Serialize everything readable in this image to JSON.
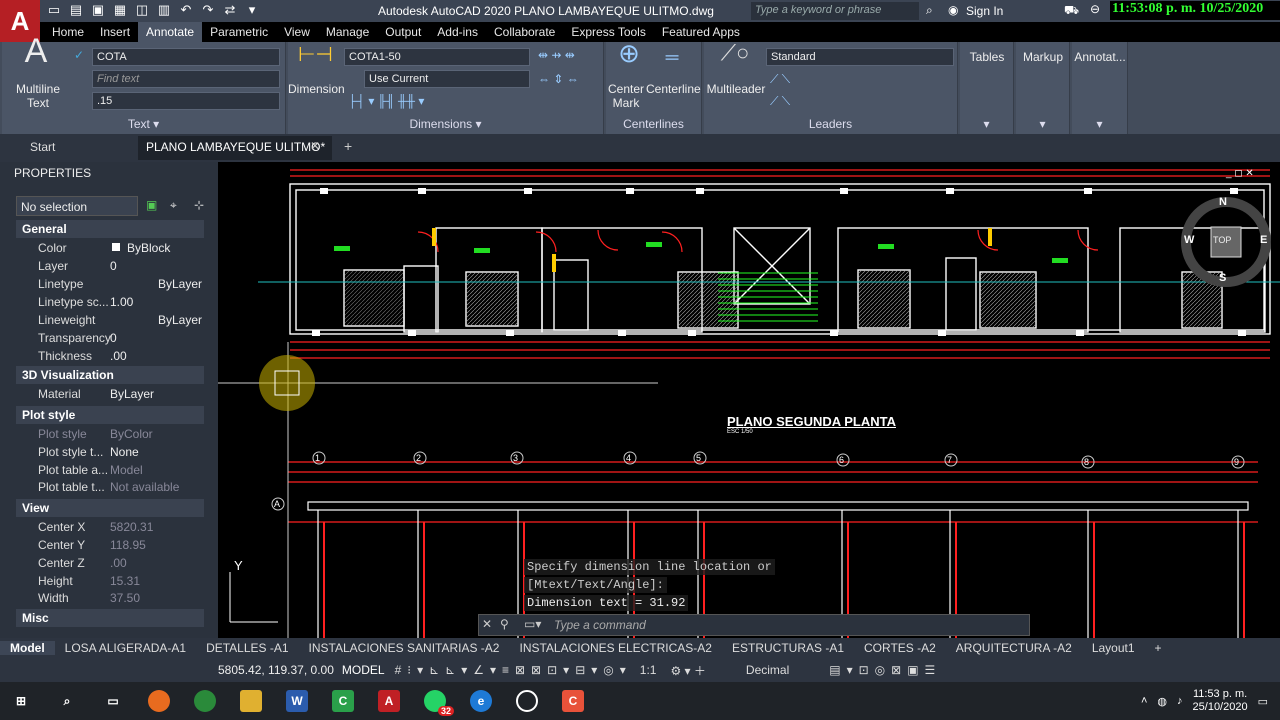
{
  "app": {
    "logo": "A",
    "title": "Autodesk AutoCAD 2020   PLANO LAMBAYEQUE ULITMO.dwg",
    "search_placeholder": "Type a keyword or phrase",
    "sign_in": "Sign In",
    "clock": "11:53:08 p. m. 10/25/2020"
  },
  "ribbon_tabs": [
    "Home",
    "Insert",
    "Annotate",
    "Parametric",
    "View",
    "Manage",
    "Output",
    "Add-ins",
    "Collaborate",
    "Express Tools",
    "Featured Apps"
  ],
  "ribbon": {
    "text": {
      "multiline": "Multiline",
      "text": "Text",
      "style": "COTA",
      "find": "Find text",
      "height": ".15",
      "label": "Text"
    },
    "dimensions": {
      "dimension": "Dimension",
      "style": "COTA1-50",
      "layer": "Use Current",
      "label": "Dimensions"
    },
    "centerlines": {
      "center_mark_1": "Center",
      "center_mark_2": "Mark",
      "centerline": "Centerline",
      "label": "Centerlines"
    },
    "leaders": {
      "multileader": "Multileader",
      "style": "Standard",
      "label": "Leaders"
    },
    "tables": "Tables",
    "markup": "Markup",
    "annotation": "Annotat..."
  },
  "doc_tabs": {
    "start": "Start",
    "file": "PLANO LAMBAYEQUE ULITMO*"
  },
  "properties": {
    "title": "PROPERTIES",
    "selection": "No selection",
    "general": {
      "title": "General",
      "rows": [
        [
          "Color",
          "ByBlock"
        ],
        [
          "Layer",
          "0"
        ],
        [
          "Linetype",
          "ByLayer"
        ],
        [
          "Linetype sc...",
          "1.00"
        ],
        [
          "Lineweight",
          "ByLayer"
        ],
        [
          "Transparency",
          "0"
        ],
        [
          "Thickness",
          ".00"
        ]
      ]
    },
    "viz": {
      "title": "3D Visualization",
      "rows": [
        [
          "Material",
          "ByLayer"
        ]
      ]
    },
    "plot": {
      "title": "Plot style",
      "rows": [
        [
          "Plot style",
          "ByColor"
        ],
        [
          "Plot style t...",
          "None"
        ],
        [
          "Plot table a...",
          "Model"
        ],
        [
          "Plot table t...",
          "Not available"
        ]
      ]
    },
    "view": {
      "title": "View",
      "rows": [
        [
          "Center X",
          "5820.31"
        ],
        [
          "Center Y",
          "118.95"
        ],
        [
          "Center Z",
          ".00"
        ],
        [
          "Height",
          "15.31"
        ],
        [
          "Width",
          "37.50"
        ]
      ]
    },
    "misc": "Misc"
  },
  "drawing": {
    "title": "PLANO SEGUNDA PLANTA",
    "scale": "ESC 1/50",
    "axes": [
      "1",
      "2",
      "3",
      "4",
      "5",
      "6",
      "7",
      "8",
      "9"
    ],
    "row_a": "A",
    "compass": {
      "n": "N",
      "s": "S",
      "e": "E",
      "w": "W",
      "top": "TOP"
    }
  },
  "command": {
    "tip1": "Specify dimension line location or",
    "tip2": "[Mtext/Text/Angle]:",
    "tip3": "Dimension text = 31.92",
    "placeholder": "Type a command"
  },
  "layouts": [
    "Model",
    "LOSA ALIGERADA-A1",
    "DETALLES -A1",
    "INSTALACIONES SANITARIAS -A2",
    "INSTALACIONES ELECTRICAS-A2",
    "ESTRUCTURAS -A1",
    "CORTES -A2",
    "ARQUITECTURA -A2",
    "Layout1",
    "+"
  ],
  "status": {
    "coords": "5805.42, 119.37, 0.00",
    "model": "MODEL",
    "scale": "1:1",
    "units": "Decimal"
  },
  "taskbar": {
    "time": "11:53 p. m.",
    "date": "25/10/2020",
    "badge": "32"
  }
}
